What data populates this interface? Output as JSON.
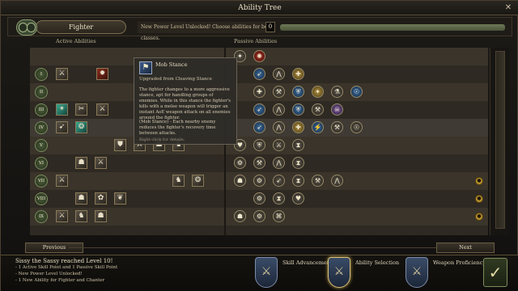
{
  "window": {
    "title": "Ability Tree",
    "close_glyph": "✕"
  },
  "class_tab": {
    "label": "Fighter"
  },
  "notice": {
    "text": "New Power Level Unlocked! Choose abilities for both classes.",
    "count": "0"
  },
  "columns": {
    "active": "Active Abilities",
    "passive": "Passive Abilities"
  },
  "tiers": [
    "I",
    "II",
    "III",
    "IV",
    "V",
    "VI",
    "VII",
    "VIII",
    "IX"
  ],
  "tooltip": {
    "title": "Mob Stance",
    "subtitle": "Upgraded from Cleaving Stance",
    "body": "The fighter changes to a more aggressive stance, apt for handling groups of enemies. While in this stance the fighter's kills with a melee weapon will trigger an instant AoE weapon attack on all enemies around the fighter.",
    "note": "(Mob Stance) - Each nearby enemy reduces the fighter's recovery time between attacks.",
    "hint": "Right-click for details."
  },
  "nav": {
    "previous": "Previous",
    "next": "Next"
  },
  "log": {
    "title": "Sissy the Sassy reached Level 10!",
    "lines": [
      "- 1 Active Skill Point and 1 Passive Skill Point",
      "- New Power Level Unlocked!",
      "- 1 New Ability for Fighter and Chanter"
    ]
  },
  "steps": [
    {
      "label": "Skill Advancement"
    },
    {
      "label": "Ability Selection"
    },
    {
      "label": "Weapon Proficiency"
    }
  ],
  "colors": {
    "accent": "#d8c078",
    "row_highlight": "#3f3a33",
    "lock": "#b8922c"
  }
}
